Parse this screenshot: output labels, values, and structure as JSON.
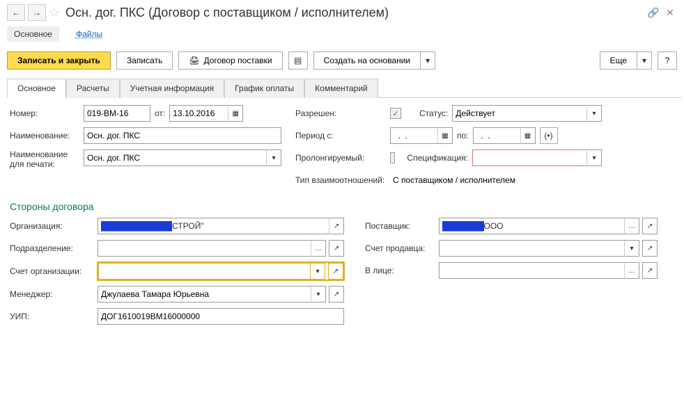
{
  "title": "Осн. дог. ПКС (Договор с поставщиком / исполнителем)",
  "subtabs": {
    "main": "Основное",
    "files": "Файлы"
  },
  "toolbar": {
    "save_close": "Записать и закрыть",
    "save": "Записать",
    "print": "Договор поставки",
    "create_on": "Создать на основании",
    "more": "Еще",
    "help": "?"
  },
  "tabs": [
    "Основное",
    "Расчеты",
    "Учетная информация",
    "График оплаты",
    "Комментарий"
  ],
  "f": {
    "nomer_lbl": "Номер:",
    "nomer": "019-ВМ-16",
    "ot_lbl": "от:",
    "ot": "13.10.2016",
    "razr_lbl": "Разрешен:",
    "status_lbl": "Статус:",
    "status": "Действует",
    "naim_lbl": "Наименование:",
    "naim": "Осн. дог. ПКС",
    "period_lbl": "Период с:",
    "period_s": "  .  .    ",
    "po_lbl": "по:",
    "period_po": "  .  .    ",
    "naim_pr_lbl": "Наименование для печати:",
    "naim_pr": "Осн. дог. ПКС",
    "prolong_lbl": "Пролонгируемый:",
    "spec_lbl": "Спецификация:",
    "spec": "",
    "tip_lbl": "Тип взаимоотношений:",
    "tip": "С поставщиком / исполнителем",
    "section": "Стороны договора",
    "org_lbl": "Организация:",
    "org_vis": "СТРОЙ\"",
    "podr_lbl": "Подразделение:",
    "podr": "",
    "schet_org_lbl": "Счет организации:",
    "schet_org": "",
    "manager_lbl": "Менеджер:",
    "manager": "Джулаева Тамара Юрьевна",
    "uip_lbl": "УИП:",
    "uip": "ДОГ1610019ВМ16000000",
    "post_lbl": "Поставщик:",
    "post_vis": " ООО",
    "schet_pr_lbl": "Счет продавца:",
    "schet_pr": "",
    "vlice_lbl": "В лице:",
    "vlice": ""
  }
}
